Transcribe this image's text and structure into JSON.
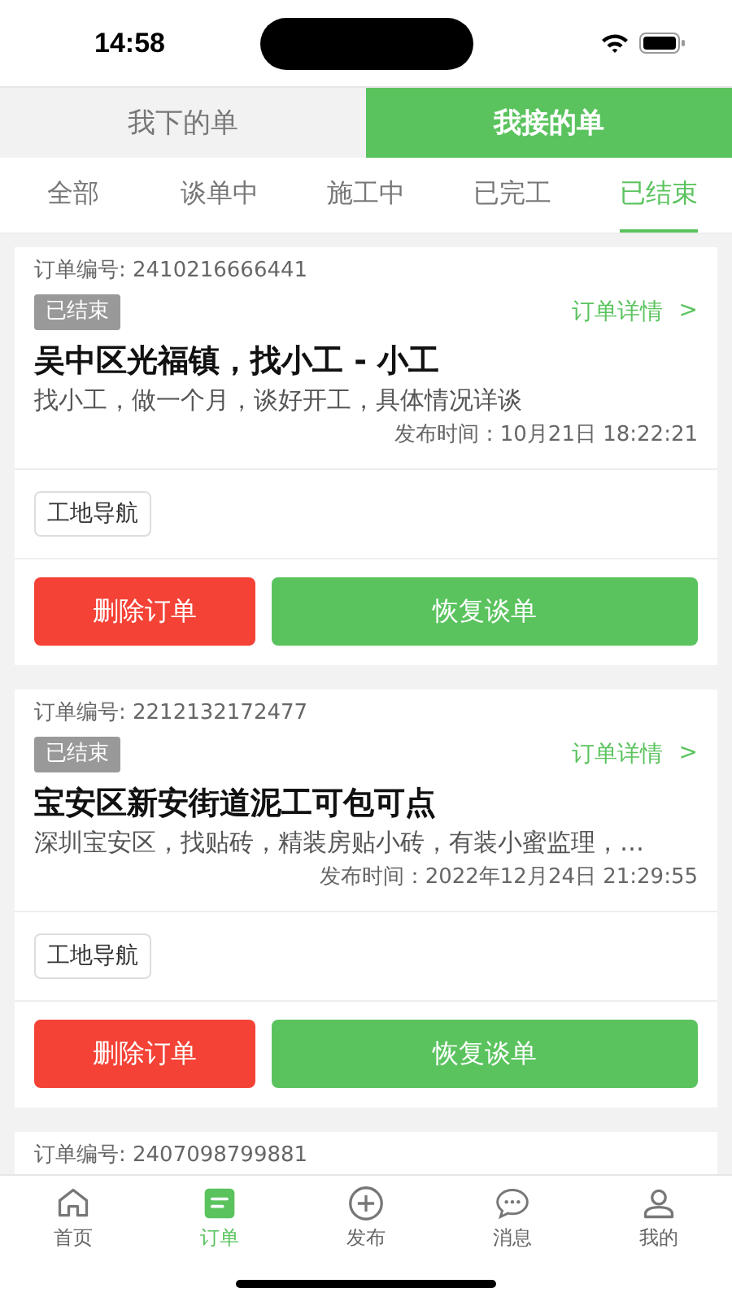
{
  "status_bar": {
    "time": "14:58"
  },
  "top_tabs": [
    {
      "label": "我下的单",
      "selected": false
    },
    {
      "label": "我接的单",
      "selected": true
    }
  ],
  "filter_tabs": [
    {
      "label": "全部",
      "selected": false
    },
    {
      "label": "谈单中",
      "selected": false
    },
    {
      "label": "施工中",
      "selected": false
    },
    {
      "label": "已完工",
      "selected": false
    },
    {
      "label": "已结束",
      "selected": true
    }
  ],
  "orders": [
    {
      "order_no": "订单编号: 2410216666441",
      "status": "已结束",
      "detail_link": "订单详情",
      "detail_arrow": ">",
      "title": "吴中区光福镇，找小工 - 小工",
      "description": "找小工，做一个月，谈好开工，具体情况详谈",
      "published": "发布时间：10月21日 18:22:21",
      "nav_button": "工地导航",
      "actions": [
        "删除订单",
        "恢复谈单"
      ]
    },
    {
      "order_no": "订单编号: 2212132172477",
      "status": "已结束",
      "detail_link": "订单详情",
      "detail_arrow": ">",
      "title": "宝安区新安街道泥工可包可点",
      "description": "深圳宝安区，找贴砖，精装房贴小砖，有装小蜜监理，…",
      "published": "发布时间：2022年12月24日 21:29:55",
      "nav_button": "工地导航",
      "actions": [
        "删除订单",
        "恢复谈单"
      ]
    },
    {
      "order_no": "订单编号: 2407098799881"
    }
  ],
  "bottom_nav": [
    {
      "label": "首页",
      "selected": false
    },
    {
      "label": "订单",
      "selected": true
    },
    {
      "label": "发布",
      "selected": false
    },
    {
      "label": "消息",
      "selected": false
    },
    {
      "label": "我的",
      "selected": false
    }
  ]
}
